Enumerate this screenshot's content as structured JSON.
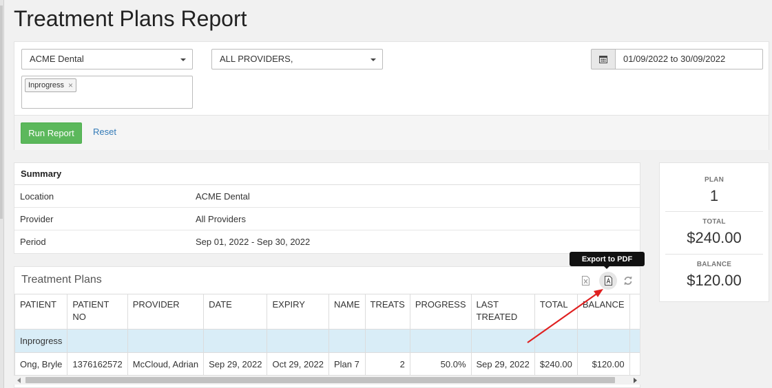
{
  "page": {
    "title": "Treatment Plans Report"
  },
  "filters": {
    "location": "ACME Dental",
    "provider": "ALL PROVIDERS,",
    "status_tag": "Inprogress",
    "tag_remove": "×",
    "date_range": "01/09/2022 to 30/09/2022",
    "run_label": "Run Report",
    "reset_label": "Reset"
  },
  "summary": {
    "heading": "Summary",
    "rows": [
      {
        "label": "Location",
        "value": "ACME Dental"
      },
      {
        "label": "Provider",
        "value": "All Providers"
      },
      {
        "label": "Period",
        "value": "Sep 01, 2022 - Sep 30, 2022"
      }
    ]
  },
  "stats": {
    "plan_label": "PLAN",
    "plan_value": "1",
    "total_label": "TOTAL",
    "total_value": "$240.00",
    "balance_label": "BALANCE",
    "balance_value": "$120.00"
  },
  "treatment_plans": {
    "title": "Treatment Plans",
    "tooltip": "Export to PDF",
    "columns": [
      "PATIENT",
      "PATIENT NO",
      "PROVIDER",
      "DATE",
      "EXPIRY",
      "NAME",
      "TREATS",
      "PROGRESS",
      "LAST TREATED",
      "TOTAL",
      "BALANCE"
    ],
    "group_label": "Inprogress",
    "rows": [
      {
        "patient": "Ong, Bryle",
        "patient_no": "1376162572",
        "provider": "McCloud, Adrian",
        "date": "Sep 29, 2022",
        "expiry": "Oct 29, 2022",
        "name": "Plan 7",
        "treats": "2",
        "progress": "50.0%",
        "last_treated": "Sep 29, 2022",
        "total": "$240.00",
        "balance": "$120.00"
      }
    ]
  },
  "icons": {
    "calendar": "calendar-icon",
    "excel": "excel-export-icon",
    "pdf": "pdf-export-icon",
    "refresh": "refresh-icon"
  },
  "colors": {
    "run_button": "#5cb85c",
    "link": "#337ab7",
    "group_row": "#d9edf7",
    "annotation_arrow": "#e02020"
  }
}
